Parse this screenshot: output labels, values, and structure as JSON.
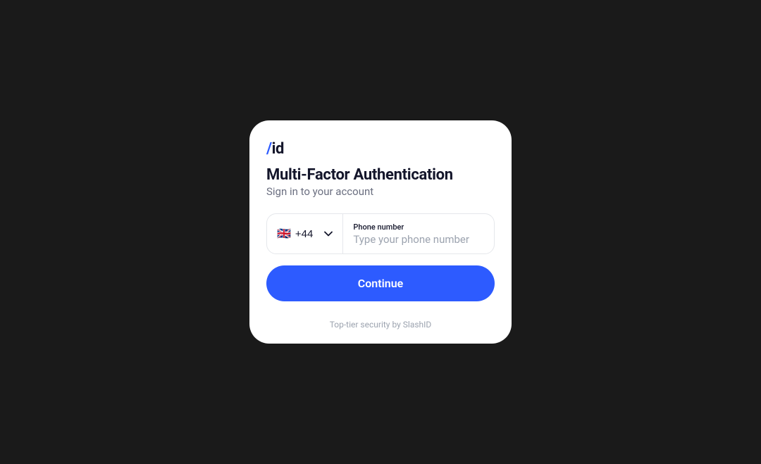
{
  "logo": {
    "slash": "/",
    "text": "id"
  },
  "title": "Multi-Factor Authentication",
  "subtitle": "Sign in to your account",
  "countrySelector": {
    "flag": "🇬🇧",
    "dialCode": "+44"
  },
  "phoneField": {
    "label": "Phone number",
    "placeholder": "Type your phone number"
  },
  "continueButton": {
    "label": "Continue"
  },
  "footer": "Top-tier security by SlashID"
}
